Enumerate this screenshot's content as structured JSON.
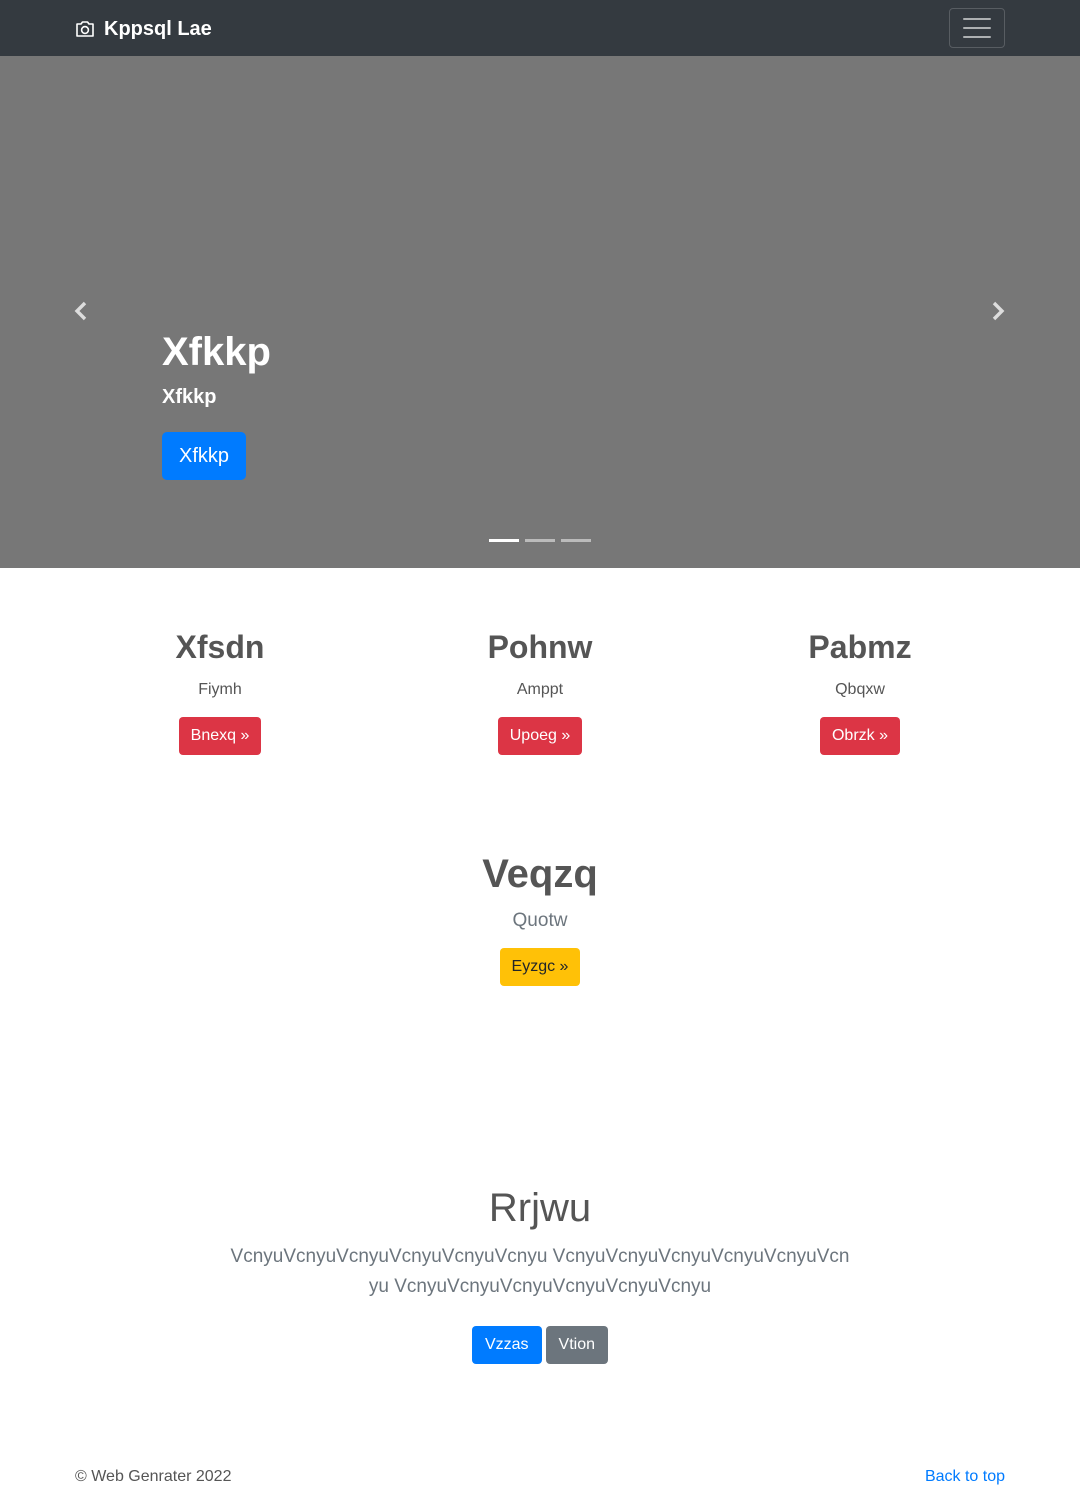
{
  "navbar": {
    "brand_icon": "camera-icon",
    "brand": "Kppsql Lae",
    "toggler_icon": "hamburger-menu-icon"
  },
  "carousel": {
    "prev_icon": "chevron-left-icon",
    "next_icon": "chevron-right-icon",
    "title": "Xfkkp",
    "subtitle": "Xfkkp",
    "button": "Xfkkp",
    "slide_count": 3,
    "active_slide": 1
  },
  "columns": [
    {
      "title": "Xfsdn",
      "text": "Fiymh",
      "button": "Bnexq »"
    },
    {
      "title": "Pohnw",
      "text": "Amppt",
      "button": "Upoeg »"
    },
    {
      "title": "Pabmz",
      "text": "Qbqxw",
      "button": "Obrzk »"
    }
  ],
  "feature": {
    "title": "Veqzq",
    "text": "Quotw",
    "button": "Eyzgc »"
  },
  "jumbo": {
    "title": "Rrjwu",
    "text": "VcnyuVcnyuVcnyuVcnyuVcnyuVcnyu VcnyuVcnyuVcnyuVcnyuVcnyuVcnyu VcnyuVcnyuVcnyuVcnyuVcnyuVcnyu",
    "primary_button": "Vzzas",
    "secondary_button": "Vtion"
  },
  "footer": {
    "copyright": "© Web Genrater 2022",
    "back_to_top": "Back to top"
  },
  "colors": {
    "navbar": "#343a40",
    "carousel": "#777777",
    "primary": "#007bff",
    "danger": "#dc3545",
    "warning": "#ffc107",
    "secondary": "#6c757d"
  }
}
